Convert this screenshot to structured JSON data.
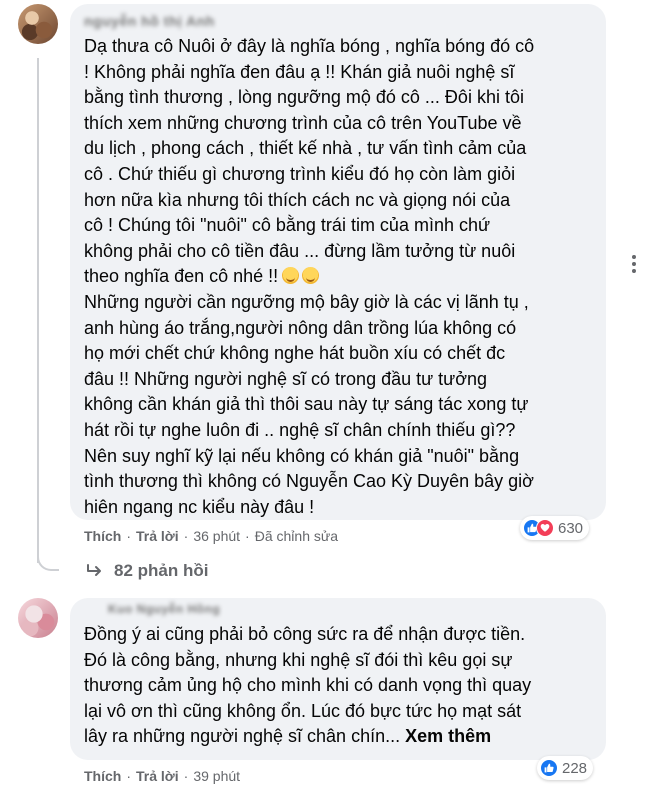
{
  "comments": [
    {
      "author": "nguyễn hồ thị Anh",
      "text_lines": [
        "Dạ thưa cô Nuôi ở đây là nghĩa bóng , nghĩa bóng đó cô",
        "! Không phải nghĩa đen đâu ạ !! Khán giả nuôi nghệ sĩ",
        "bằng tình thương , lòng ngưỡng mộ đó cô ... Đôi khi tôi",
        "thích xem những chương trình của cô trên YouTube về",
        "du lịch , phong cách , thiết kế nhà , tư vấn tình cảm của",
        "cô . Chứ thiếu gì chương trình kiểu đó họ còn làm giỏi",
        "hơn nữa kìa nhưng tôi thích cách nc và giọng nói của",
        "cô ! Chúng tôi \"nuôi\" cô bằng trái tim của mình chứ",
        "không phải cho cô tiền đâu ... đừng lầm tưởng từ nuôi",
        "theo nghĩa đen cô nhé !!",
        "Những người cần ngưỡng mộ bây giờ là các vị lãnh tụ ,",
        "anh hùng áo trắng,người nông dân trồng lúa không có",
        "họ mới chết chứ không nghe hát buồn xíu có chết đc",
        "đâu !! Những người nghệ sĩ có trong đầu tư tưởng",
        "không cần khán giả thì thôi sau này tự sáng tác xong tự",
        "hát rồi tự nghe luôn đi .. nghệ sĩ chân chính thiếu gì??",
        "Nên suy nghĩ kỹ lại nếu không có khán giả \"nuôi\" bằng",
        "tình thương thì không có Nguyễn Cao Kỳ Duyên bây giờ",
        "hiên ngang nc kiểu này đâu !"
      ],
      "emoji_names": [
        "smirk-emoji",
        "smirk-emoji"
      ],
      "like_label": "Thích",
      "reply_label": "Trả lời",
      "time": "36 phút",
      "edited_label": "Đã chỉnh sửa",
      "reaction_count": "630",
      "reaction_icons": [
        "like-icon",
        "love-icon"
      ],
      "replies_label": "82 phản hồi"
    },
    {
      "author": "Kuo Nguyễn Hồng",
      "text_lines": [
        "Đồng ý ai cũng phải bỏ công sức ra để nhận được tiền.",
        "Đó là công bằng, nhưng khi nghệ sĩ đói thì kêu gọi sự",
        "thương cảm ủng hộ cho mình khi có danh vọng thì quay",
        "lại vô ơn thì cũng không ổn. Lúc đó bực tức họ mạt sát",
        "lây ra những người nghệ sĩ chân chín..."
      ],
      "see_more": "Xem thêm",
      "like_label": "Thích",
      "reply_label": "Trả lời",
      "time": "39 phút",
      "reaction_count": "228",
      "reaction_icons": [
        "like-icon"
      ]
    }
  ],
  "colors": {
    "bubble": "#f0f2f5",
    "text": "#050505",
    "secondary": "#65676b",
    "like": "#1877f2",
    "love": "#f33e58"
  }
}
